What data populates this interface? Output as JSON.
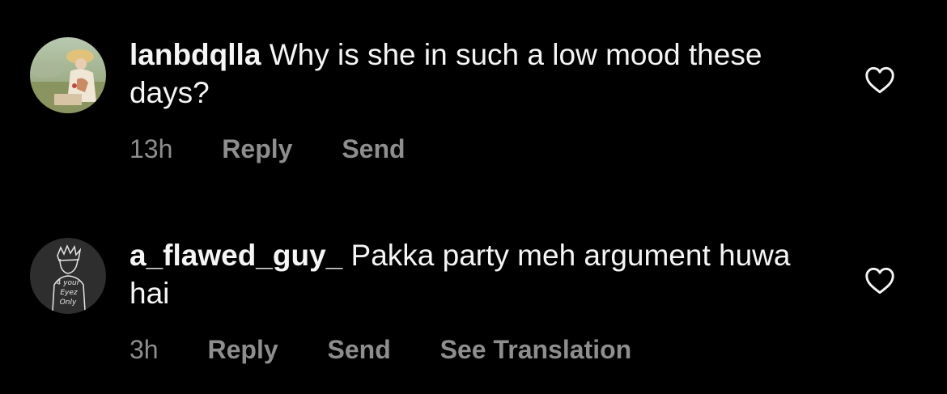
{
  "comments": [
    {
      "username": "lanbdqlla",
      "text": "Why is she in such a low mood these days?",
      "time": "13h",
      "actions": [
        "Reply",
        "Send"
      ],
      "avatar_icon": "painting-avatar-icon"
    },
    {
      "username": "a_flawed_guy_",
      "text": "Pakka party meh argument huwa hai",
      "time": "3h",
      "actions": [
        "Reply",
        "Send",
        "See Translation"
      ],
      "avatar_icon": "sketch-avatar-icon",
      "avatar_text": [
        "4 your",
        "Eyez",
        "Only"
      ]
    }
  ],
  "colors": {
    "background": "#000000",
    "text": "#f5f5f5",
    "secondary": "#8e8e8e"
  },
  "icons": {
    "like": "heart-outline-icon"
  }
}
